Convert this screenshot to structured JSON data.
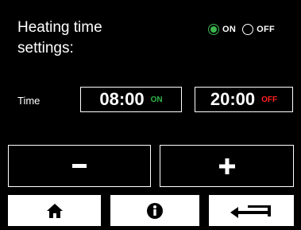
{
  "header": {
    "title_line1": "Heating time",
    "title_line2": "settings:"
  },
  "mode": {
    "options": [
      {
        "label": "ON",
        "selected": true
      },
      {
        "label": "OFF",
        "selected": false
      }
    ]
  },
  "time_row": {
    "label": "Time",
    "start": {
      "value": "08:00",
      "state": "ON"
    },
    "end": {
      "value": "20:00",
      "state": "OFF"
    }
  },
  "controls": {
    "decrement_icon": "minus-icon",
    "increment_icon": "plus-icon"
  },
  "nav": {
    "home_icon": "home-icon",
    "info_icon": "info-icon",
    "back_icon": "return-arrow-icon"
  },
  "colors": {
    "background": "#000000",
    "foreground": "#ffffff",
    "on_accent": "#2fb34a",
    "off_accent": "#ff2020"
  }
}
